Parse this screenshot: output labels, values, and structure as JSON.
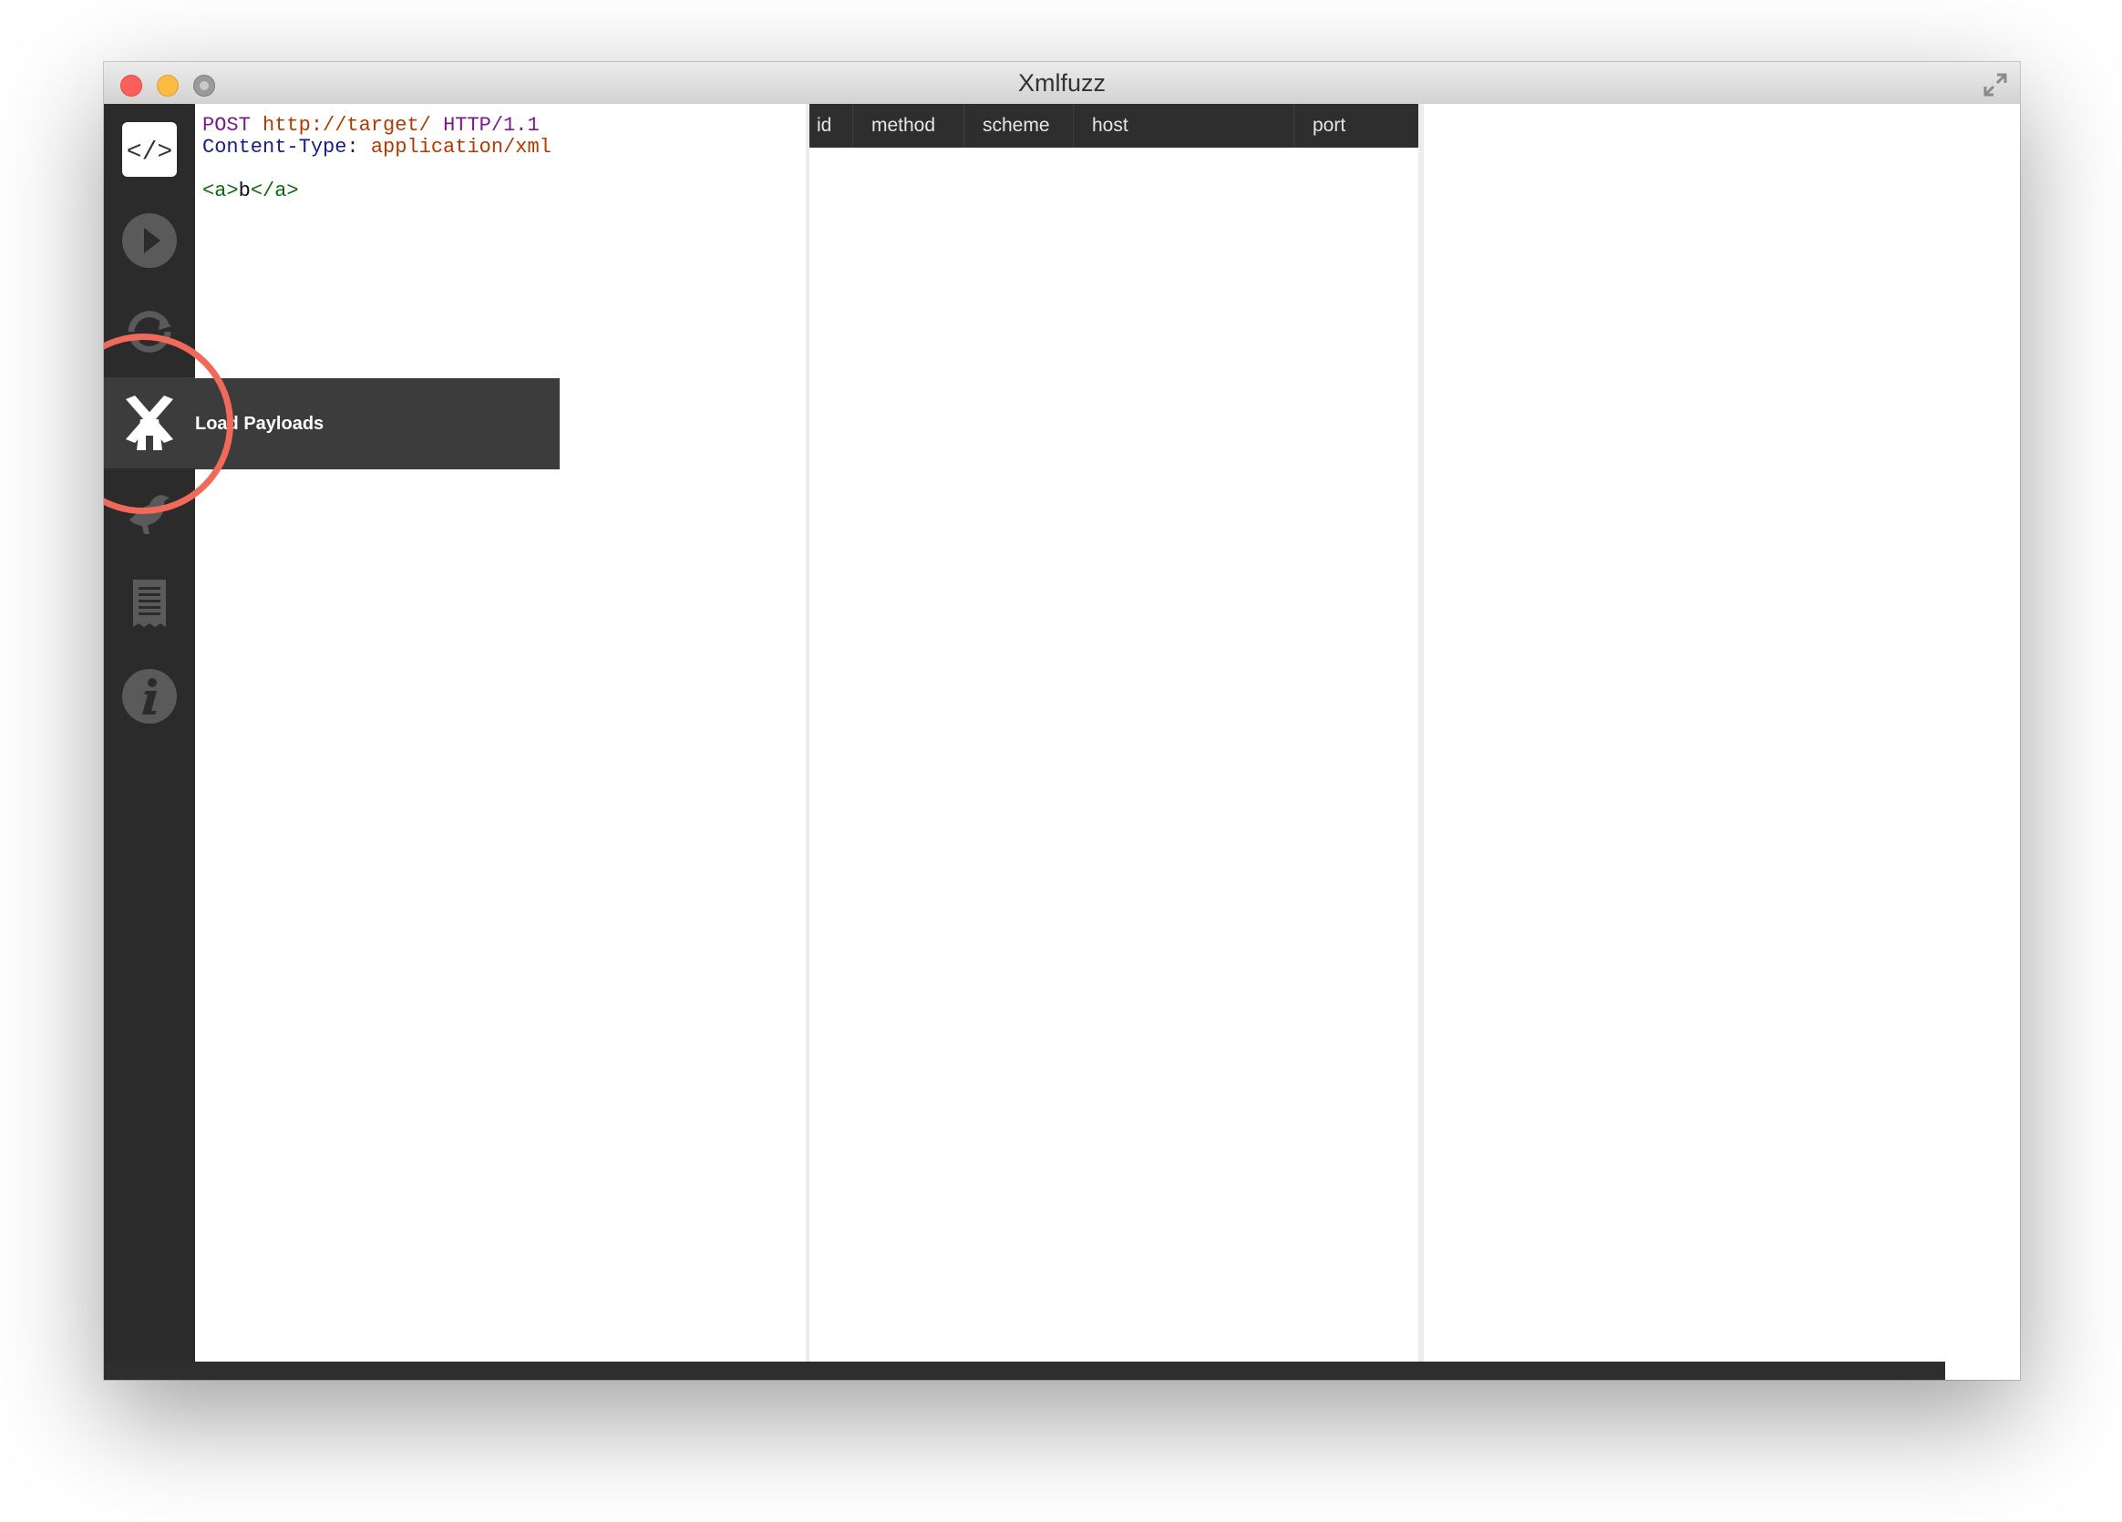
{
  "window": {
    "title": "Xmlfuzz"
  },
  "sidebar": {
    "items": [
      {
        "icon": "code-icon"
      },
      {
        "icon": "play-icon"
      },
      {
        "icon": "refresh-icon"
      },
      {
        "icon": "windmill-icon",
        "tooltip": "Load Payloads"
      },
      {
        "icon": "bird-icon"
      },
      {
        "icon": "document-icon"
      },
      {
        "icon": "info-icon"
      }
    ]
  },
  "editor": {
    "line1": {
      "method": "POST",
      "url": "http://target/",
      "version": "HTTP/1.1"
    },
    "line2": {
      "header_name": "Content-Type:",
      "header_value": "application/xml"
    },
    "body": {
      "open_tag": "<a>",
      "text": "b",
      "close_tag": "</a>"
    }
  },
  "results": {
    "columns": [
      "id",
      "method",
      "scheme",
      "host",
      "port"
    ]
  }
}
